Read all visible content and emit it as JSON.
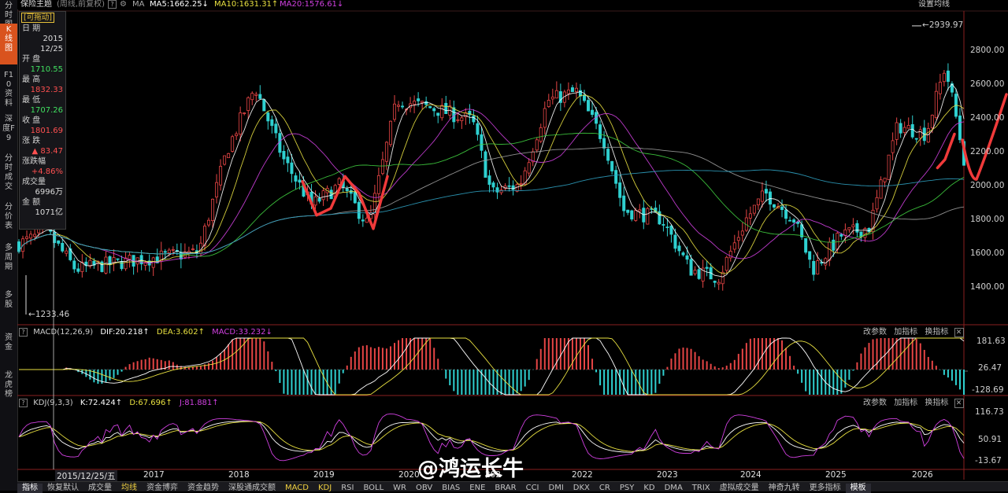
{
  "left_tabs": [
    {
      "label": "分时图",
      "active": false
    },
    {
      "label": "K线图",
      "active": true
    },
    {
      "label": "F10资料",
      "active": false
    },
    {
      "label": "深度F9",
      "active": false
    },
    {
      "label": "分时成交",
      "active": false
    },
    {
      "label": "分价表",
      "active": false
    },
    {
      "label": "多周期",
      "active": false
    },
    {
      "label": "多股",
      "active": false
    },
    {
      "label": "资金",
      "active": false
    },
    {
      "label": "龙虎榜",
      "active": false
    }
  ],
  "topbar": {
    "title": "保险主题",
    "period": "(周线,前复权)",
    "ma_label": "MA",
    "ma5": "MA5:1662.25↓",
    "ma10": "MA10:1631.31↑",
    "ma20": "MA20:1576.61↓",
    "settings": "设置均线"
  },
  "info_panel": {
    "drag_label": "[可拖动]",
    "date_label": "日 期",
    "date_year": "2015",
    "date_md": "12/25",
    "open_label": "开 盘",
    "open": "1710.55",
    "high_label": "最 高",
    "high": "1832.33",
    "low_label": "最 低",
    "low": "1707.26",
    "close_label": "收 盘",
    "close": "1801.69",
    "change_label": "涨 跌",
    "change": "▲ 83.47",
    "pct_label": "涨跌幅",
    "pct": "+4.86%",
    "volume_label": "成交量",
    "volume": "6996万",
    "amount_label": "金 额",
    "amount": "1071亿"
  },
  "price_axis": [
    "2800.00",
    "2600.00",
    "2400.00",
    "2200.00",
    "2000.00",
    "1800.00",
    "1600.00",
    "1400.00"
  ],
  "price_markers": {
    "high": "2939.97",
    "low": "1233.46"
  },
  "macd_panel": {
    "title": "MACD(12,26,9)",
    "dif": "DIF:20.218↑",
    "dea": "DEA:3.602↑",
    "macd": "MACD:33.232↓",
    "axis": [
      "181.63",
      "26.47",
      "-128.69"
    ],
    "tool_params": "改参数",
    "tool_add": "加指标",
    "tool_swap": "换指标",
    "close": "✕"
  },
  "kdj_panel": {
    "title": "KDJ(9,3,3)",
    "k": "K:72.424↑",
    "d": "D:67.696↑",
    "j": "J:81.881↑",
    "axis": [
      "116.73",
      "50.91",
      "-13.67"
    ],
    "tool_params": "改参数",
    "tool_add": "加指标",
    "tool_swap": "换指标",
    "close": "✕"
  },
  "time_axis": {
    "cursor_date": "2015/12/25/五",
    "years": [
      "2017",
      "2018",
      "2019",
      "2020",
      "202",
      "2022",
      "2023",
      "2024",
      "2025",
      "2026"
    ]
  },
  "bottom_tabs": [
    {
      "label": "指标",
      "state": "sel"
    },
    {
      "label": "恢复默认",
      "state": ""
    },
    {
      "label": "成交量",
      "state": ""
    },
    {
      "label": "均线",
      "state": "hl"
    },
    {
      "label": "资金博弈",
      "state": ""
    },
    {
      "label": "资金趋势",
      "state": ""
    },
    {
      "label": "深股通成交额",
      "state": ""
    },
    {
      "label": "MACD",
      "state": "hl"
    },
    {
      "label": "KDJ",
      "state": "hl"
    },
    {
      "label": "RSI",
      "state": ""
    },
    {
      "label": "BOLL",
      "state": ""
    },
    {
      "label": "WR",
      "state": ""
    },
    {
      "label": "OBV",
      "state": ""
    },
    {
      "label": "BIAS",
      "state": ""
    },
    {
      "label": "ENE",
      "state": ""
    },
    {
      "label": "BRAR",
      "state": ""
    },
    {
      "label": "CCI",
      "state": ""
    },
    {
      "label": "DMI",
      "state": ""
    },
    {
      "label": "DKX",
      "state": ""
    },
    {
      "label": "CR",
      "state": ""
    },
    {
      "label": "PSY",
      "state": ""
    },
    {
      "label": "KD",
      "state": ""
    },
    {
      "label": "DMA",
      "state": ""
    },
    {
      "label": "TRIX",
      "state": ""
    },
    {
      "label": "虚拟成交量",
      "state": ""
    },
    {
      "label": "神奇九转",
      "state": ""
    },
    {
      "label": "更多指标",
      "state": ""
    },
    {
      "label": "模板",
      "state": "sel"
    }
  ],
  "watermark": "@鸿运长牛",
  "colors": {
    "up": "#e64545",
    "down": "#2fd0d0",
    "ma5": "#ffffff",
    "ma10": "#e8e040",
    "ma20": "#d040e0",
    "ma60": "#40d040",
    "ma120": "#a0a0a0",
    "ma250": "#2fa0c0",
    "hand_drawn": "#f03a3a",
    "accent": "#d9531e"
  },
  "chart_data": {
    "type": "candlestick",
    "title": "保险主题",
    "period": "weekly",
    "y_range": [
      1233.46,
      2939.97
    ],
    "y_ticks": [
      1400,
      1600,
      1800,
      2000,
      2200,
      2400,
      2600,
      2800
    ],
    "max_label": 2939.97,
    "min_label": 1233.46,
    "selected_bar": {
      "date": "2015-12-25",
      "open": 1710.55,
      "high": 1832.33,
      "low": 1707.26,
      "close": 1801.69
    },
    "years": [
      "2017",
      "2018",
      "2019",
      "2020",
      "2021",
      "2022",
      "2023",
      "2024",
      "2025",
      "2026"
    ],
    "approx_close_path": [
      {
        "t": 0.0,
        "v": 1650
      },
      {
        "t": 0.03,
        "v": 1720
      },
      {
        "t": 0.06,
        "v": 1500
      },
      {
        "t": 0.13,
        "v": 1560
      },
      {
        "t": 0.19,
        "v": 1600
      },
      {
        "t": 0.22,
        "v": 2200
      },
      {
        "t": 0.25,
        "v": 2580
      },
      {
        "t": 0.28,
        "v": 2150
      },
      {
        "t": 0.31,
        "v": 1880
      },
      {
        "t": 0.34,
        "v": 2000
      },
      {
        "t": 0.37,
        "v": 1760
      },
      {
        "t": 0.4,
        "v": 2500
      },
      {
        "t": 0.44,
        "v": 2450
      },
      {
        "t": 0.48,
        "v": 2380
      },
      {
        "t": 0.5,
        "v": 1950
      },
      {
        "t": 0.53,
        "v": 2000
      },
      {
        "t": 0.56,
        "v": 2500
      },
      {
        "t": 0.59,
        "v": 2550
      },
      {
        "t": 0.62,
        "v": 2250
      },
      {
        "t": 0.64,
        "v": 1850
      },
      {
        "t": 0.68,
        "v": 1800
      },
      {
        "t": 0.71,
        "v": 1500
      },
      {
        "t": 0.74,
        "v": 1450
      },
      {
        "t": 0.77,
        "v": 1800
      },
      {
        "t": 0.79,
        "v": 1950
      },
      {
        "t": 0.82,
        "v": 1800
      },
      {
        "t": 0.84,
        "v": 1500
      },
      {
        "t": 0.87,
        "v": 1700
      },
      {
        "t": 0.9,
        "v": 1750
      },
      {
        "t": 0.93,
        "v": 2350
      },
      {
        "t": 0.96,
        "v": 2300
      },
      {
        "t": 0.98,
        "v": 2700
      },
      {
        "t": 0.99,
        "v": 2450
      },
      {
        "t": 1.0,
        "v": 2150
      }
    ],
    "hand_drawn_path": [
      {
        "t": 0.3,
        "v": 2020
      },
      {
        "t": 0.315,
        "v": 1820
      },
      {
        "t": 0.33,
        "v": 1860
      },
      {
        "t": 0.345,
        "v": 2050
      },
      {
        "t": 0.36,
        "v": 1950
      },
      {
        "t": 0.375,
        "v": 1740
      },
      {
        "t": 0.39,
        "v": 2050
      },
      {
        "t": 0.972,
        "v": 2100
      },
      {
        "t": 0.98,
        "v": 2150
      },
      {
        "t": 0.99,
        "v": 2300
      }
    ]
  }
}
